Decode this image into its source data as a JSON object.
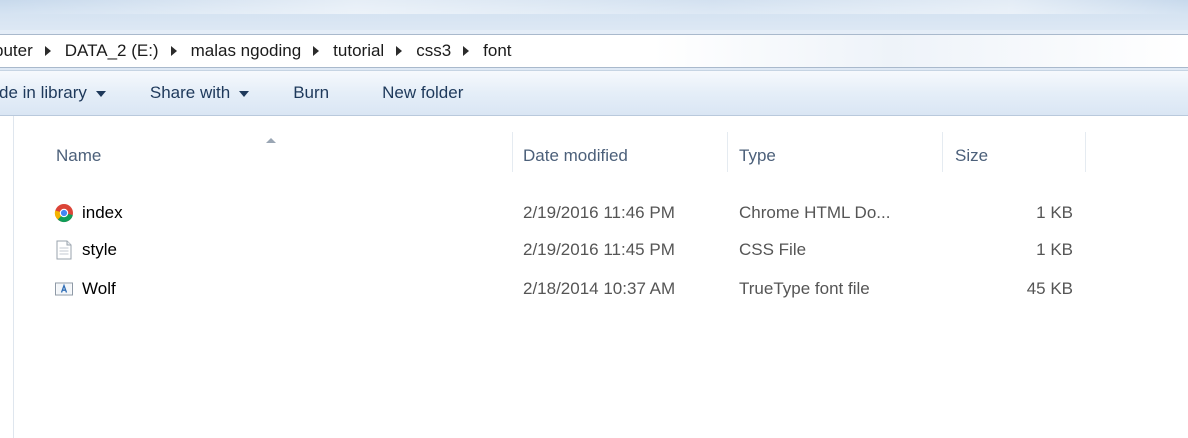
{
  "breadcrumb": {
    "items": [
      "puter",
      "DATA_2 (E:)",
      "malas ngoding",
      "tutorial",
      "css3",
      "font"
    ]
  },
  "toolbar": {
    "include_library": "de in library",
    "share_with": "Share with",
    "burn": "Burn",
    "new_folder": "New folder"
  },
  "columns": {
    "name": "Name",
    "date_modified": "Date modified",
    "type": "Type",
    "size": "Size"
  },
  "files": [
    {
      "name": "index",
      "date": "2/19/2016 11:46 PM",
      "type": "Chrome HTML Do...",
      "size": "1 KB",
      "icon": "chrome-html-file-icon"
    },
    {
      "name": "style",
      "date": "2/19/2016 11:45 PM",
      "type": "CSS File",
      "size": "1 KB",
      "icon": "css-file-icon"
    },
    {
      "name": "Wolf",
      "date": "2/18/2014 10:37 AM",
      "type": "TrueType font file",
      "size": "45 KB",
      "icon": "truetype-font-file-icon"
    }
  ],
  "colors": {
    "toolbar_text": "#1e395b",
    "header_text": "#4c607a"
  }
}
